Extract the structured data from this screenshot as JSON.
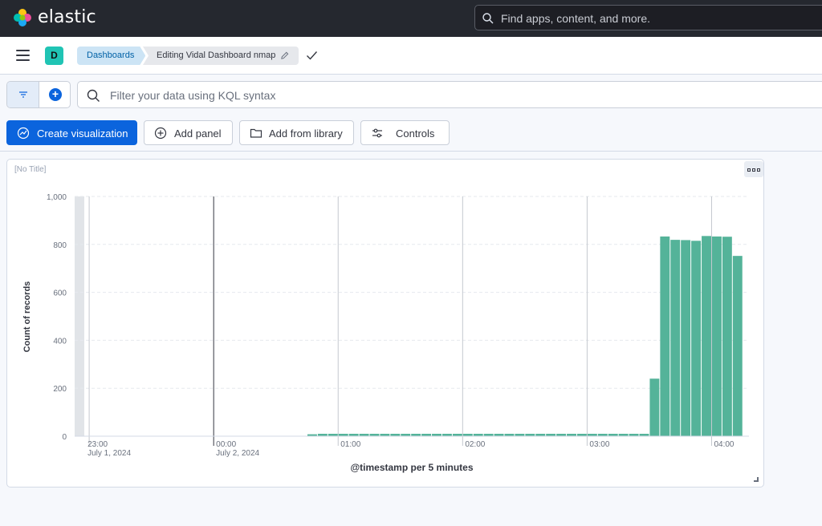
{
  "header": {
    "brand": "elastic",
    "search_placeholder": "Find apps, content, and more."
  },
  "navbar": {
    "space_initial": "D",
    "breadcrumbs": [
      "Dashboards",
      "Editing Vidal Dashboard nmap"
    ]
  },
  "query": {
    "placeholder": "Filter your data using KQL syntax"
  },
  "toolbar": {
    "create_label": "Create visualization",
    "add_panel_label": "Add panel",
    "library_label": "Add from library",
    "controls_label": "Controls"
  },
  "panel": {
    "title": "[No Title]"
  },
  "colors": {
    "bar": "#54b399",
    "primary": "#0b64dd",
    "header_bg": "#25282f"
  },
  "chart_data": {
    "type": "bar",
    "xlabel": "@timestamp per 5 minutes",
    "ylabel": "Count of records",
    "ylim": [
      0,
      1000
    ],
    "yticks": [
      "0",
      "200",
      "400",
      "600",
      "800",
      "1,000"
    ],
    "xticks": [
      {
        "time": "23:00",
        "date": "July 1, 2024"
      },
      {
        "time": "00:00",
        "date": "July 2, 2024"
      },
      {
        "time": "01:00",
        "date": ""
      },
      {
        "time": "02:00",
        "date": ""
      },
      {
        "time": "03:00",
        "date": ""
      },
      {
        "time": "04:00",
        "date": ""
      }
    ],
    "grid": true,
    "bars": [
      {
        "start": "00:45",
        "value": 8
      },
      {
        "start": "00:50",
        "value": 10
      },
      {
        "start": "00:55",
        "value": 10
      },
      {
        "start": "01:00",
        "value": 10
      },
      {
        "start": "01:05",
        "value": 10
      },
      {
        "start": "01:10",
        "value": 10
      },
      {
        "start": "01:15",
        "value": 10
      },
      {
        "start": "01:20",
        "value": 10
      },
      {
        "start": "01:25",
        "value": 10
      },
      {
        "start": "01:30",
        "value": 10
      },
      {
        "start": "01:35",
        "value": 10
      },
      {
        "start": "01:40",
        "value": 10
      },
      {
        "start": "01:45",
        "value": 10
      },
      {
        "start": "01:50",
        "value": 10
      },
      {
        "start": "01:55",
        "value": 10
      },
      {
        "start": "02:00",
        "value": 10
      },
      {
        "start": "02:05",
        "value": 10
      },
      {
        "start": "02:10",
        "value": 10
      },
      {
        "start": "02:15",
        "value": 10
      },
      {
        "start": "02:20",
        "value": 10
      },
      {
        "start": "02:25",
        "value": 10
      },
      {
        "start": "02:30",
        "value": 10
      },
      {
        "start": "02:35",
        "value": 10
      },
      {
        "start": "02:40",
        "value": 10
      },
      {
        "start": "02:45",
        "value": 10
      },
      {
        "start": "02:50",
        "value": 10
      },
      {
        "start": "02:55",
        "value": 10
      },
      {
        "start": "03:00",
        "value": 10
      },
      {
        "start": "03:05",
        "value": 10
      },
      {
        "start": "03:10",
        "value": 10
      },
      {
        "start": "03:15",
        "value": 10
      },
      {
        "start": "03:20",
        "value": 10
      },
      {
        "start": "03:25",
        "value": 10
      },
      {
        "start": "03:30",
        "value": 240
      },
      {
        "start": "03:35",
        "value": 833
      },
      {
        "start": "03:40",
        "value": 819
      },
      {
        "start": "03:45",
        "value": 818
      },
      {
        "start": "03:50",
        "value": 815
      },
      {
        "start": "03:55",
        "value": 835
      },
      {
        "start": "04:00",
        "value": 833
      },
      {
        "start": "04:05",
        "value": 832
      },
      {
        "start": "04:10",
        "value": 752
      }
    ]
  }
}
